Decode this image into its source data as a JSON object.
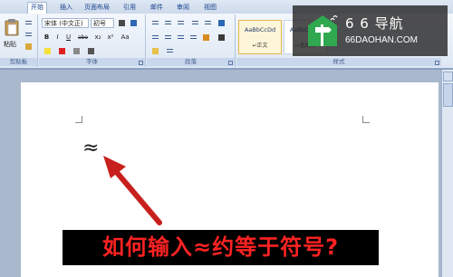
{
  "tabs": [
    "开始",
    "插入",
    "页面布局",
    "引用",
    "邮件",
    "审阅",
    "视图"
  ],
  "ribbon": {
    "paste_label": "粘贴",
    "font_name": "宋体 (中文正)",
    "font_size": "初号",
    "font_buttons": [
      "B",
      "I",
      "U",
      "abe",
      "x₂",
      "x²",
      "Aa"
    ],
    "groups": {
      "clipboard": "剪贴板",
      "font": "字体",
      "paragraph": "段落",
      "styles": "样式"
    },
    "styles": [
      {
        "sample": "AaBbCcDd",
        "name": "↵正文"
      },
      {
        "sample": "AaBbCcDd",
        "name": "↵无间隔"
      }
    ]
  },
  "document": {
    "symbol": "≈"
  },
  "banner": {
    "text": "如何输入≈约等于符号?"
  },
  "watermark": {
    "title": "6 6 导航",
    "url": "66DAOHAN.COM"
  },
  "colors": {
    "banner_bg": "#000000",
    "banner_text": "#ff2222",
    "arrow": "#c8201c",
    "logo": "#2fa84f"
  }
}
